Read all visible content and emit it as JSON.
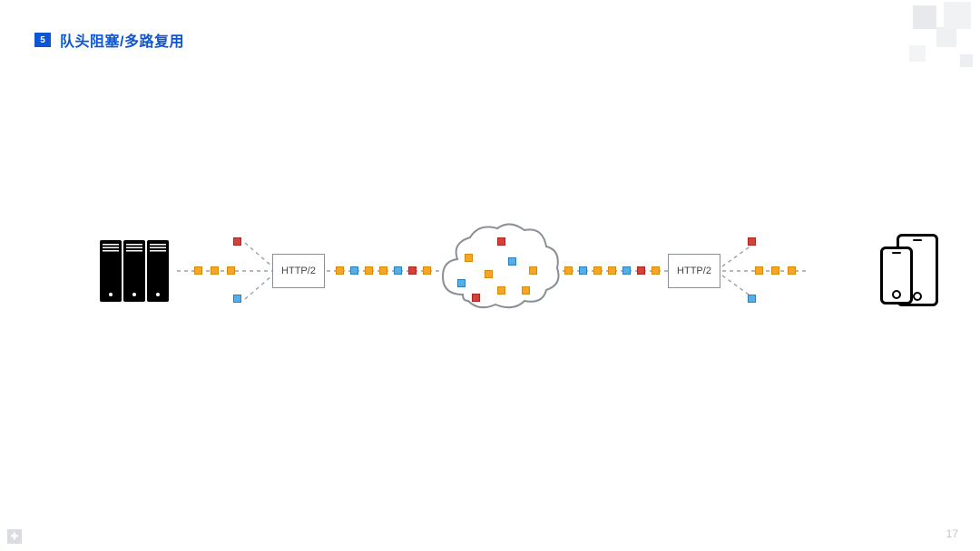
{
  "header": {
    "badge": "5",
    "title": "队头阻塞/多路复用"
  },
  "page_number": "17",
  "protocol_label": "HTTP/2",
  "diagram": {
    "left_node": "servers",
    "right_node": "mobile-devices",
    "middle_node": "network-cloud",
    "packet_colors": [
      "orange",
      "blue",
      "red"
    ]
  }
}
